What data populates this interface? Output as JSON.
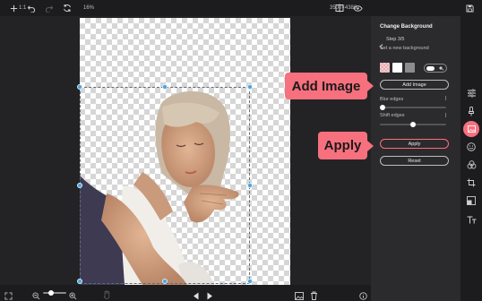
{
  "toolbar": {
    "left_icons": [
      "plus-icon",
      "undo-icon",
      "redo-icon",
      "refresh-icon"
    ],
    "right_icons": [
      "compare-icon",
      "eye-icon",
      "save-icon"
    ]
  },
  "bottombar": {
    "zoom_ratio": "1:1",
    "zoom_level": "16%",
    "zoom_fraction": 0.33,
    "dimensions": "3500×4386"
  },
  "panel": {
    "title": "Change Background",
    "step": "Step 3/5",
    "subtitle": "Set a new background",
    "swatches": [
      "#e8d2d2",
      "#ffffff",
      "#8c8c8c"
    ],
    "add_image_label": "Add Image",
    "blur_label": "Blur edges",
    "blur_fraction": 0.04,
    "shift_label": "Shift edges",
    "shift_fraction": 0.5,
    "apply_label": "Apply",
    "reset_label": "Reset"
  },
  "rail": {
    "icons": [
      "adjust-icon",
      "brush-icon",
      "image-icon",
      "sticker-icon",
      "filters-icon",
      "crop-icon",
      "resize-icon",
      "text-icon"
    ]
  },
  "callouts": {
    "add_image": "Add Image",
    "apply": "Apply"
  },
  "colors": {
    "accent": "#f7707e",
    "handle": "#4aa3df"
  }
}
